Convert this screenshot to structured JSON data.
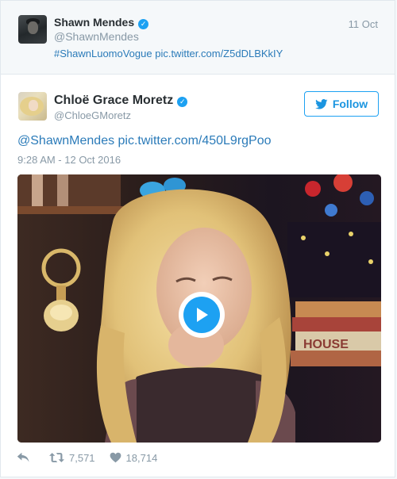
{
  "quoted_tweet": {
    "name": "Shawn Mendes",
    "handle": "@ShawnMendes",
    "date": "11 Oct",
    "text": "#ShawnLuomoVogue pic.twitter.com/Z5dDLBKkIY",
    "verified_icon": "verified-badge-icon"
  },
  "tweet": {
    "name": "Chloë Grace Moretz",
    "handle": "@ChloeGMoretz",
    "follow_label": "Follow",
    "text": "@ShawnMendes pic.twitter.com/450L9rgPoo",
    "timestamp": "9:28 AM - 12 Oct 2016",
    "verified_icon": "verified-badge-icon"
  },
  "actions": {
    "reply_icon": "reply-icon",
    "retweet_icon": "retweet-icon",
    "retweets": "7,571",
    "like_icon": "heart-icon",
    "likes": "18,714"
  },
  "colors": {
    "link": "#2b7bb9",
    "twitter_blue": "#1da1f2",
    "muted": "#8899a6"
  }
}
